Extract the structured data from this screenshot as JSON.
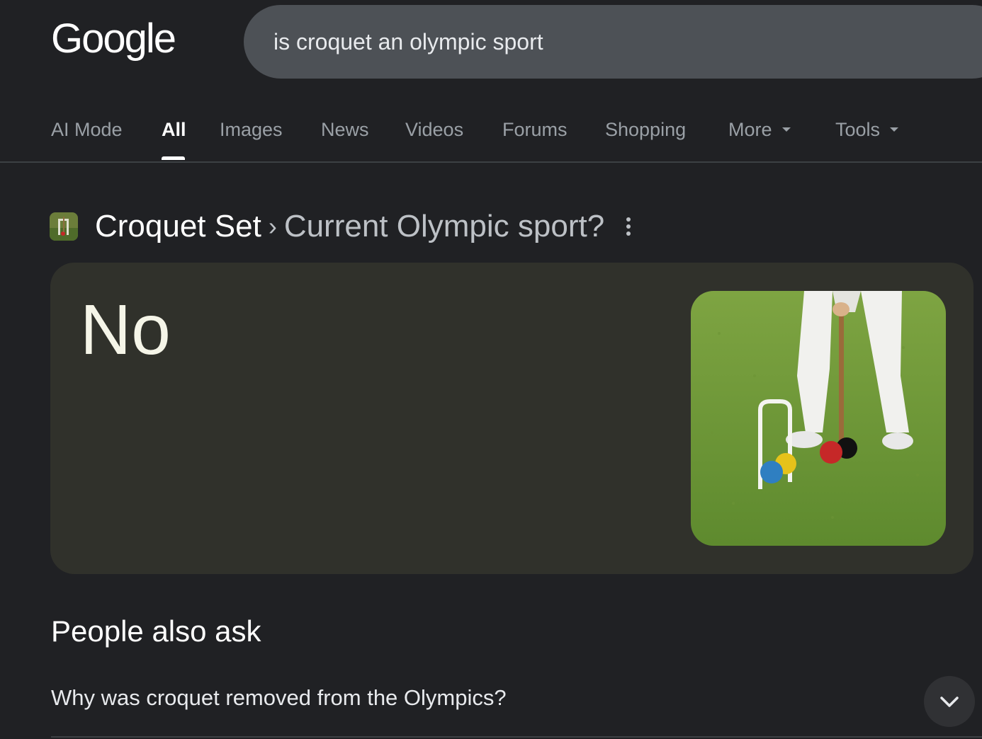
{
  "header": {
    "logo_text": "Google",
    "search": {
      "value": "is croquet an olympic sport"
    }
  },
  "tabs": {
    "items": [
      {
        "label": "AI Mode"
      },
      {
        "label": "All",
        "active": true
      },
      {
        "label": "Images"
      },
      {
        "label": "News"
      },
      {
        "label": "Videos"
      },
      {
        "label": "Forums"
      },
      {
        "label": "Shopping"
      },
      {
        "label": "More",
        "dropdown": true
      },
      {
        "label": "Tools",
        "dropdown": true
      }
    ]
  },
  "result": {
    "site_name": "Croquet Set",
    "separator": "›",
    "page_title": "Current Olympic sport?",
    "answer": "No",
    "image_icon": "croquet-photo"
  },
  "people_also_ask": {
    "title": "People also ask",
    "questions": [
      {
        "text": "Why was croquet removed from the Olympics?"
      }
    ]
  },
  "colors": {
    "background": "#202124",
    "search_bg": "#4d5156",
    "card_bg": "#30312b",
    "muted_text": "#9aa0a6"
  }
}
